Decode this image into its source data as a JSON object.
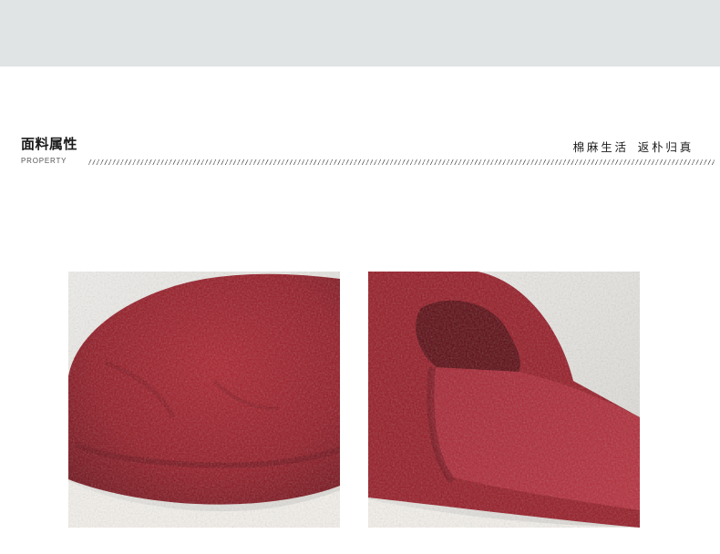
{
  "header": {
    "title": "面料属性",
    "subtitle": "PROPERTY",
    "slogan_part1": "棉麻生活",
    "slogan_part2": "返朴归真"
  },
  "photos": [
    {
      "name": "slipper-toe-closeup"
    },
    {
      "name": "slipper-side-view"
    }
  ],
  "colors": {
    "band": "#e1e4e5",
    "fabric": "#9b1b26",
    "rug": "#e8e6e2"
  }
}
